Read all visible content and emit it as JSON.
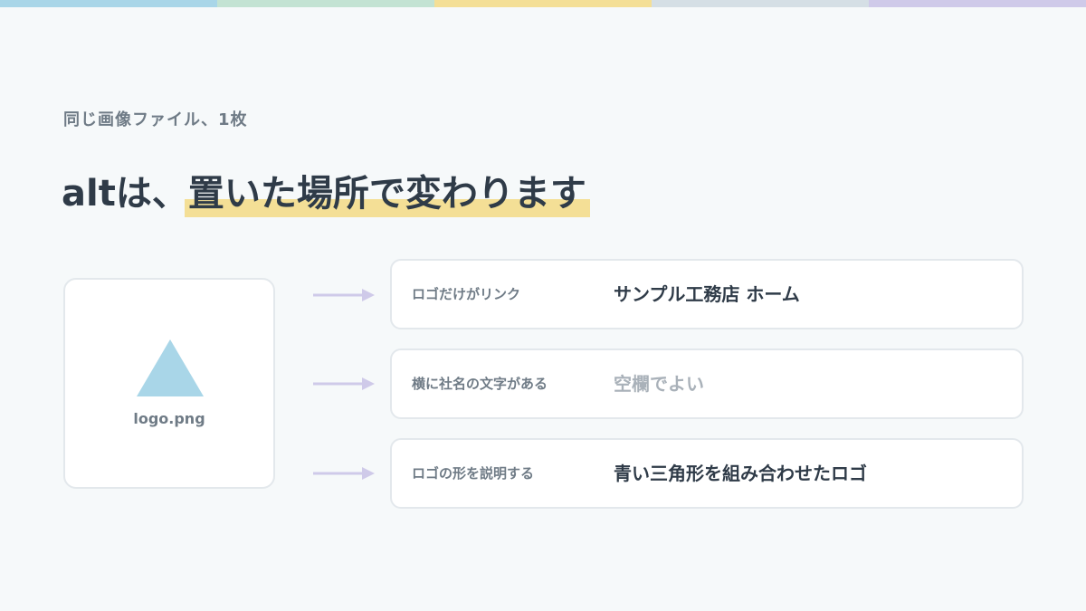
{
  "top_bar_colors": [
    "#a9d6e8",
    "#c3e3d3",
    "#f4df96",
    "#d5dfe5",
    "#cfcae9"
  ],
  "kicker": "同じ画像ファイル、1枚",
  "headline": {
    "prefix": "altは、",
    "highlight": "置いた場所で変わります",
    "highlight_color": "#f4df96"
  },
  "image_card": {
    "icon": "triangle-icon",
    "icon_color": "#a9d6e8",
    "filename": "logo.png"
  },
  "arrow_color": "#cfcae9",
  "rows": [
    {
      "context": "ロゴだけがリンク",
      "alt": "サンプル工務店 ホーム",
      "muted": false
    },
    {
      "context": "横に社名の文字がある",
      "alt": "空欄でよい",
      "muted": true
    },
    {
      "context": "ロゴの形を説明する",
      "alt": "青い三角形を組み合わせたロゴ",
      "muted": false
    }
  ]
}
